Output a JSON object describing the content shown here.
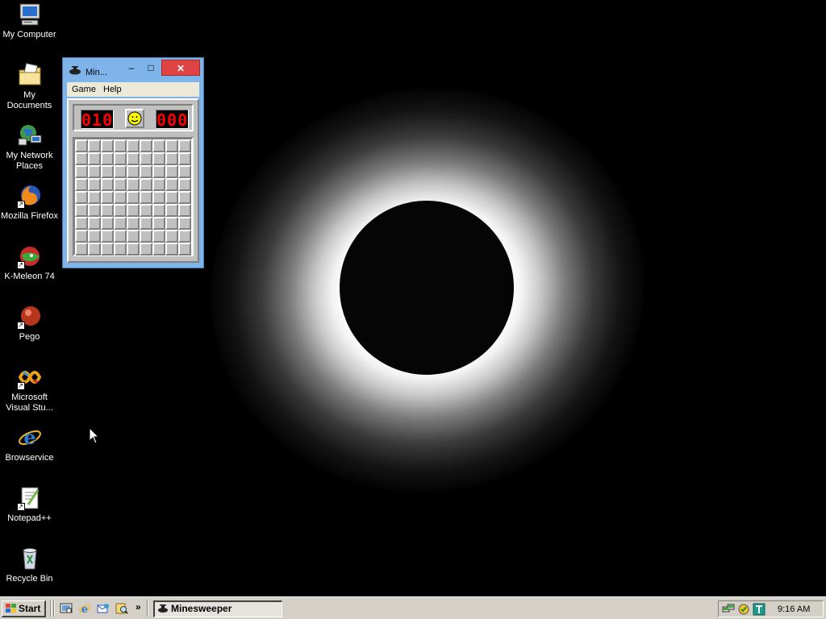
{
  "desktop": {
    "icons": [
      {
        "label": "My Computer",
        "icon": "my-computer-icon"
      },
      {
        "label": "My Documents",
        "icon": "my-documents-icon"
      },
      {
        "label": "My Network Places",
        "icon": "network-places-icon"
      },
      {
        "label": "Mozilla Firefox",
        "icon": "firefox-icon"
      },
      {
        "label": "K-Meleon 74",
        "icon": "k-meleon-icon"
      },
      {
        "label": "Pego",
        "icon": "pego-icon"
      },
      {
        "label": "Microsoft Visual Stu...",
        "icon": "visual-studio-icon"
      },
      {
        "label": "Browservice",
        "icon": "internet-explorer-icon"
      },
      {
        "label": "Notepad++",
        "icon": "notepad-plus-plus-icon"
      },
      {
        "label": "Recycle Bin",
        "icon": "recycle-bin-icon"
      }
    ]
  },
  "window": {
    "title": "Min...",
    "minimize_label": "–",
    "maximize_label": "□",
    "close_label": "✕",
    "menu": {
      "game": "Game",
      "help": "Help"
    },
    "mine_counter": "010",
    "timer": "000",
    "face": "smiley-face-icon",
    "grid": {
      "rows": 9,
      "cols": 9
    }
  },
  "taskbar": {
    "start_label": "Start",
    "quick_launch": [
      "show-desktop-icon",
      "internet-explorer-icon",
      "outlook-express-icon",
      "search-icon"
    ],
    "more_label": "»",
    "task_label": "Minesweeper",
    "tray_icons": [
      "network-icon",
      "security-icon",
      "tray-app-icon"
    ],
    "clock": "9:16 AM"
  },
  "colors": {
    "titlebar": "#7eb4ea",
    "close_button": "#e04343",
    "lcd_red": "#ff0000",
    "taskbar": "#d4d0c8"
  }
}
